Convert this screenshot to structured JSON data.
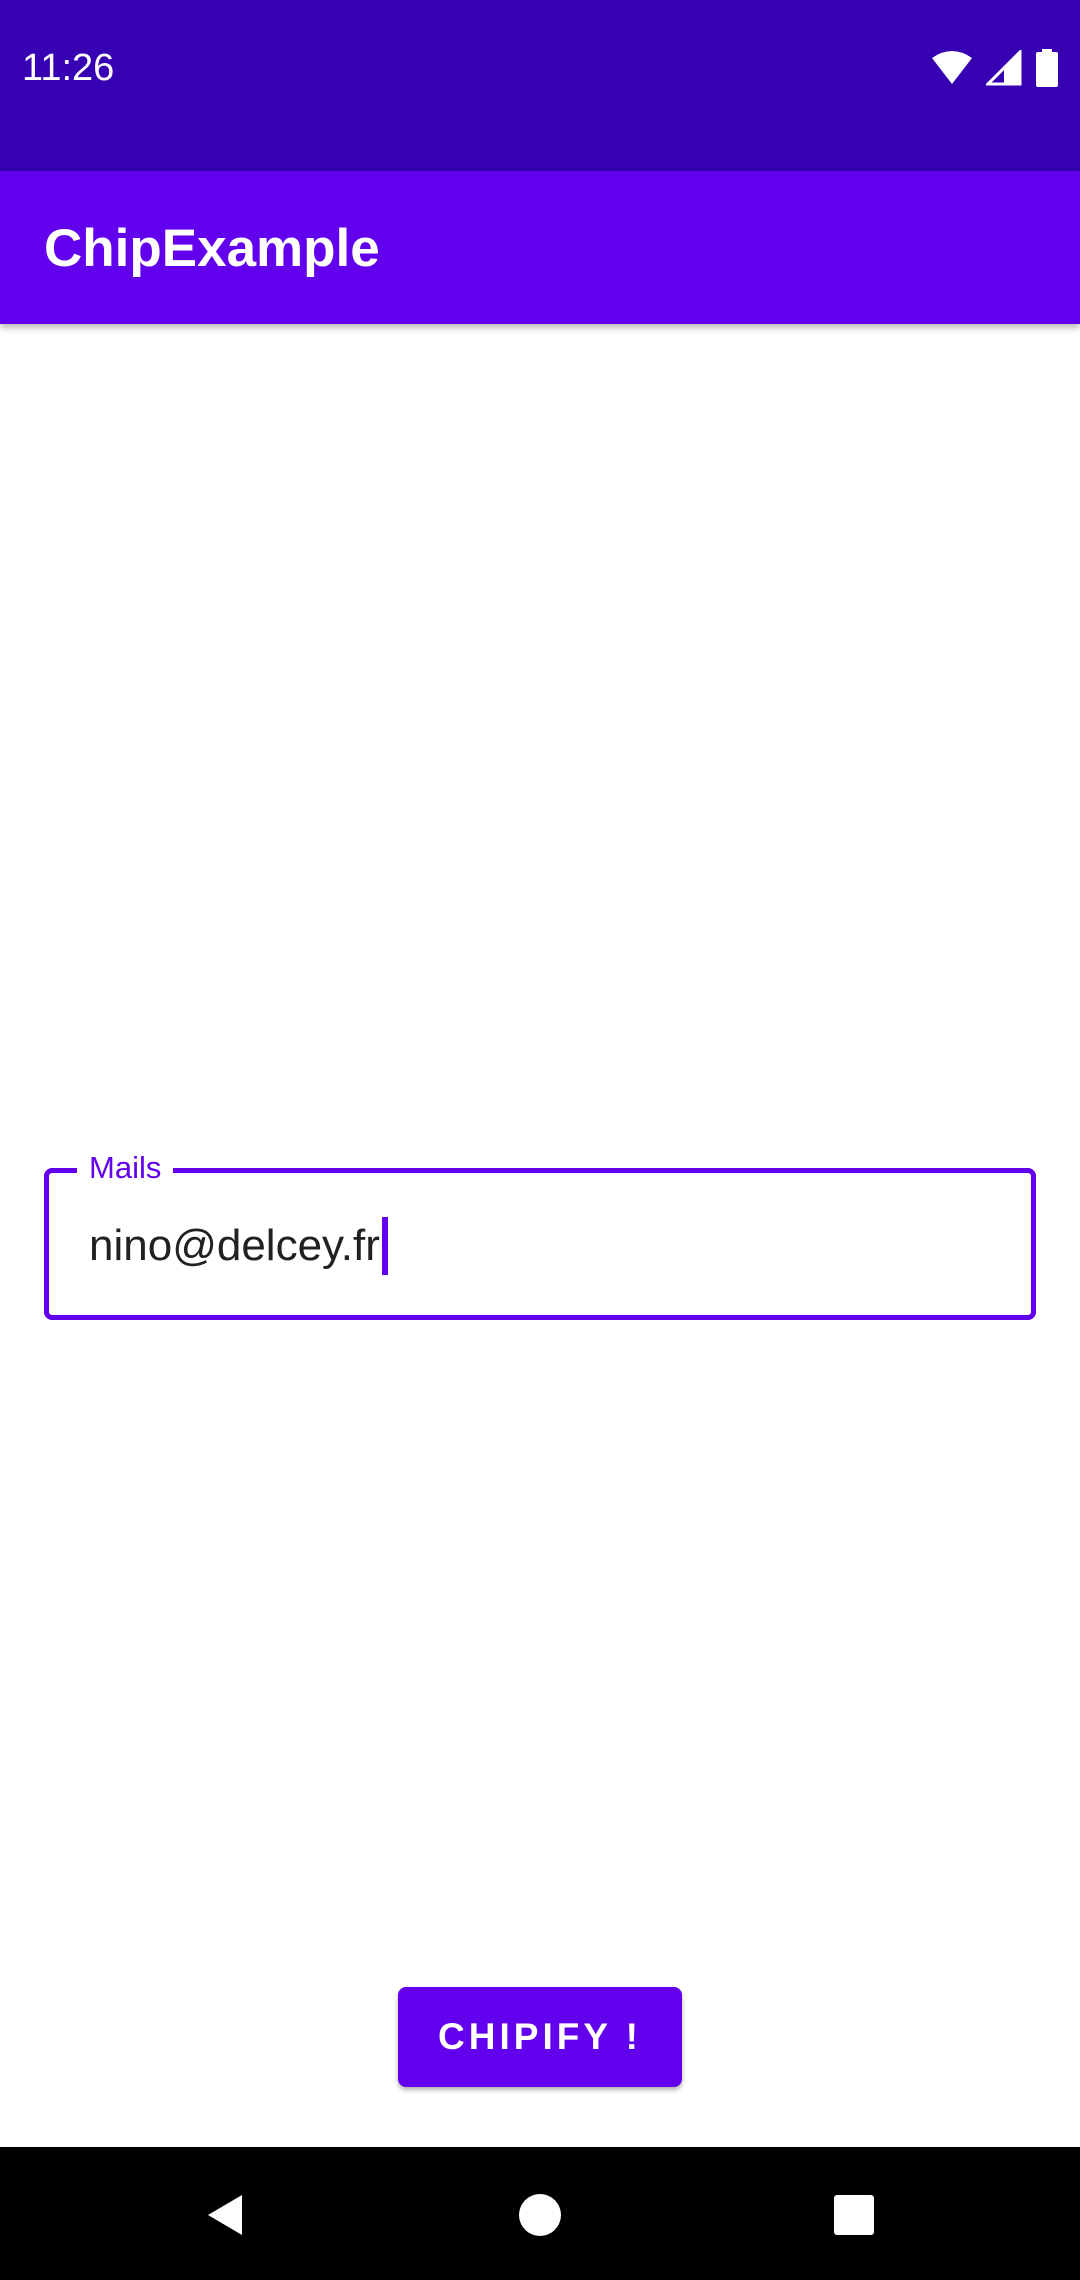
{
  "status_bar": {
    "time": "11:26",
    "icons": [
      "wifi-icon",
      "cellular-signal-icon",
      "battery-icon"
    ]
  },
  "app_bar": {
    "title": "ChipExample"
  },
  "mails_field": {
    "label": "Mails",
    "value": "nino@delcey.fr"
  },
  "chipify_button": {
    "label": "CHIPIFY !"
  },
  "nav_bar": {
    "icons": [
      "back-icon",
      "home-icon",
      "recents-icon"
    ]
  },
  "colors": {
    "status_bar": "#3700b3",
    "primary": "#6200ee",
    "background": "#ffffff",
    "nav_bar": "#000000"
  }
}
